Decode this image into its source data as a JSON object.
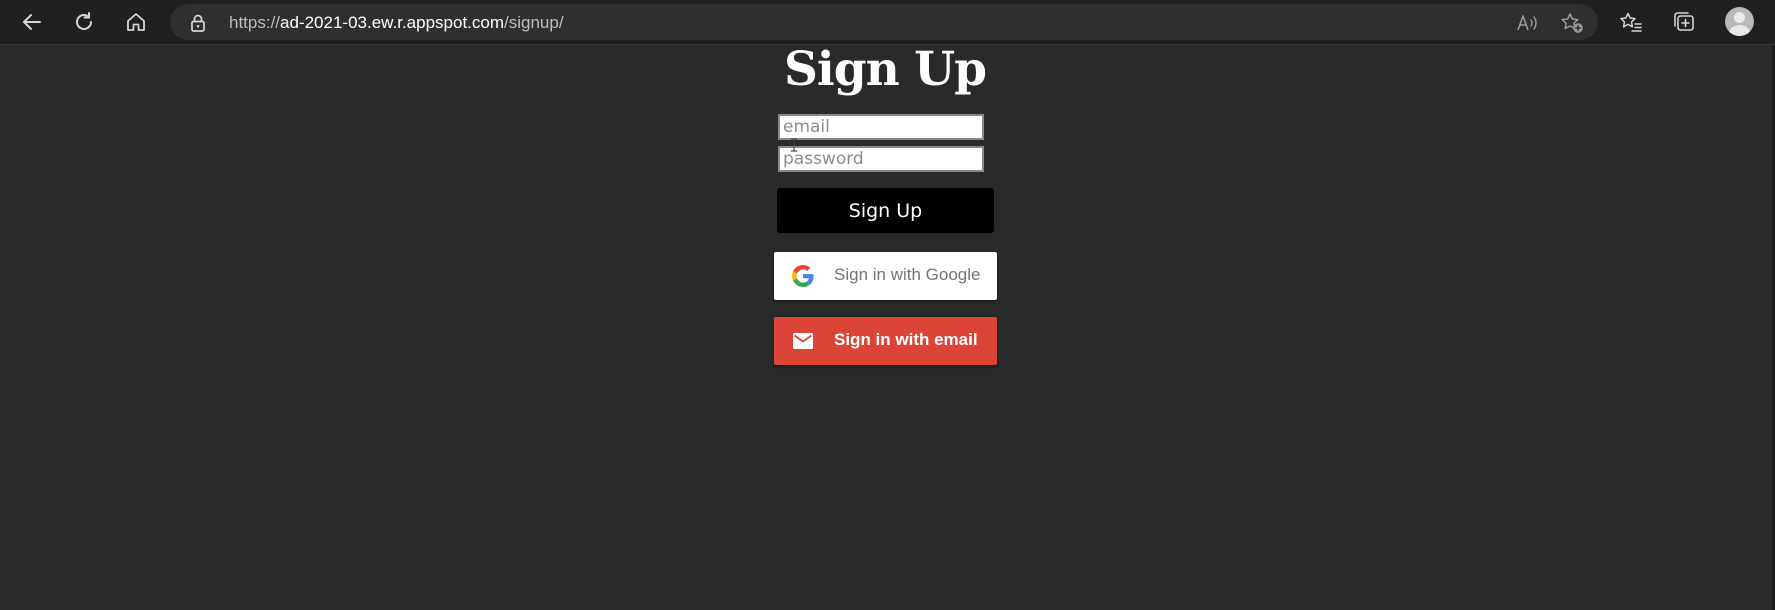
{
  "browser": {
    "url_scheme": "https://",
    "url_host": "ad-2021-03.ew.r.appspot.com",
    "url_path": "/signup/",
    "icons": {
      "back": "back-arrow-icon",
      "refresh": "refresh-icon",
      "home": "home-icon",
      "lock": "lock-icon",
      "read_aloud": "read-aloud-icon",
      "add_favorite": "add-favorite-icon",
      "favorites": "favorites-icon",
      "collections": "collections-icon",
      "profile": "profile-avatar-icon"
    }
  },
  "signup": {
    "title": "Sign Up",
    "email_placeholder": "email",
    "email_value": "",
    "password_placeholder": "password",
    "password_value": "",
    "submit_label": "Sign Up"
  },
  "providers": {
    "google_label": "Sign in with Google",
    "email_label": "Sign in with email"
  },
  "colors": {
    "page_background": "#2a2a2a",
    "browser_chrome": "#202020",
    "signup_button": "#000000",
    "google_button": "#ffffff",
    "email_button": "#db4437"
  }
}
